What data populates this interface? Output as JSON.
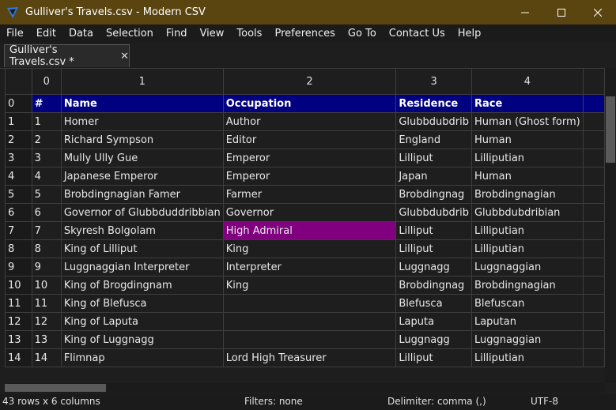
{
  "window": {
    "title": "Gulliver's Travels.csv - Modern CSV"
  },
  "menu": [
    "File",
    "Edit",
    "Data",
    "Selection",
    "Find",
    "View",
    "Tools",
    "Preferences",
    "Go To",
    "Contact Us",
    "Help"
  ],
  "tab": {
    "label": "Gulliver's Travels.csv *"
  },
  "grid": {
    "column_indices": [
      "0",
      "1",
      "2",
      "3",
      "4"
    ],
    "row_indices": [
      "0",
      "1",
      "2",
      "3",
      "4",
      "5",
      "6",
      "7",
      "8",
      "9",
      "10",
      "11",
      "12",
      "13",
      "14"
    ],
    "rows": [
      [
        "#",
        "Name",
        "Occupation",
        "Residence",
        "Race"
      ],
      [
        "1",
        "Homer",
        "Author",
        "Glubbdubdrib",
        "Human (Ghost form)"
      ],
      [
        "2",
        "Richard Sympson",
        "Editor",
        "England",
        "Human"
      ],
      [
        "3",
        "Mully Ully Gue",
        "Emperor",
        "Lilliput",
        "Lilliputian"
      ],
      [
        "4",
        "Japanese Emperor",
        "Emperor",
        "Japan",
        "Human"
      ],
      [
        "5",
        "Brobdingnagian Famer",
        "Farmer",
        "Brobdingnag",
        "Brobdingnagian"
      ],
      [
        "6",
        "Governor of Glubbduddribbian",
        "Governor",
        "Glubbdubdrib",
        "Glubbdubdribian"
      ],
      [
        "7",
        "Skyresh Bolgolam",
        "High Admiral",
        "Lilliput",
        "Lilliputian"
      ],
      [
        "8",
        "King of Lilliput",
        "King",
        "Lilliput",
        "Lilliputian"
      ],
      [
        "9",
        "Luggnaggian Interpreter",
        "Interpreter",
        "Luggnagg",
        "Luggnaggian"
      ],
      [
        "10",
        "King of Brogdingnam",
        "King",
        "Brobdingnag",
        "Brobdingnagian"
      ],
      [
        "11",
        "King of Blefusca",
        "",
        "Blefusca",
        "Blefuscan"
      ],
      [
        "12",
        "King of Laputa",
        "",
        "Laputa",
        "Laputan"
      ],
      [
        "13",
        "King of Luggnagg",
        "",
        "Luggnagg",
        "Luggnaggian"
      ],
      [
        "14",
        "Flimnap",
        "Lord High Treasurer",
        "Lilliput",
        "Lilliputian"
      ]
    ]
  },
  "status": {
    "dimensions": "43 rows x 6 columns",
    "filters": "Filters: none",
    "delimiter": "Delimiter: comma (,)",
    "encoding": "UTF-8"
  },
  "colors": {
    "titlebar": "#5a4410",
    "header_row": "#000080",
    "highlight_cell": "#800080"
  }
}
